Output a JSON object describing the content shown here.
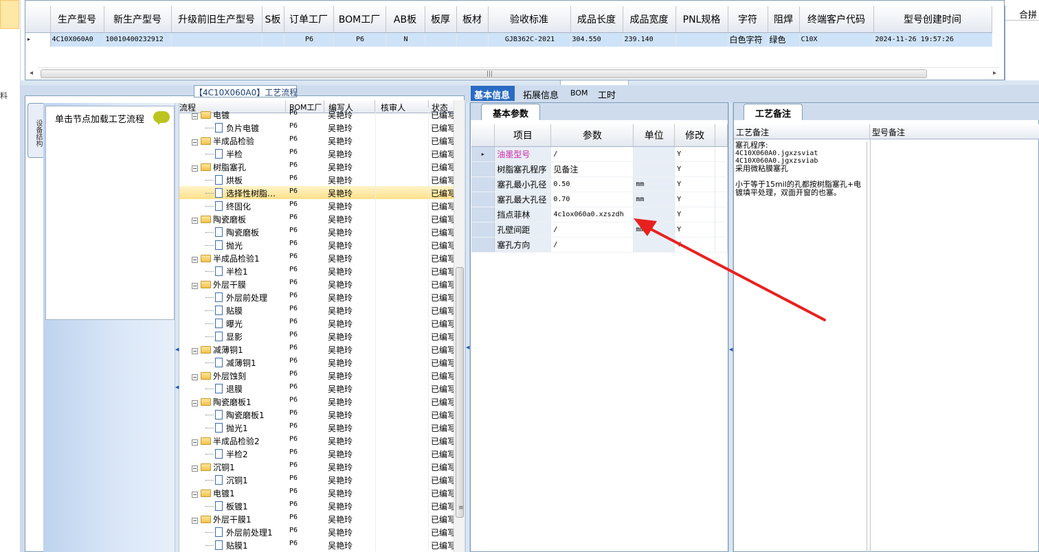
{
  "left_strip": {
    "label": "料"
  },
  "top_grid": {
    "columns": [
      "生产型号",
      "新生产型号",
      "升级前旧生产型号",
      "S板",
      "订单工厂",
      "BOM工厂",
      "AB板",
      "板厚",
      "板材",
      "验收标准",
      "成品长度",
      "成品宽度",
      "PNL规格",
      "字符",
      "阻焊",
      "终端客户代码",
      "型号创建时间"
    ],
    "row": {
      "indicator": "▸",
      "cells": [
        "4C10X060A0",
        "10010400232912",
        "",
        "",
        "P6",
        "P6",
        "N",
        "",
        "",
        "GJB362C-2021",
        "304.550",
        "239.140",
        "",
        "白色字符",
        "绿色",
        "C10X",
        "2024-11-26 19:57:26"
      ]
    },
    "right_header": "合拼",
    "scroll_grip": "|||",
    "scroll_left": "◂",
    "scroll_right": "▸"
  },
  "flow_panel": {
    "title": "【4C10X060A0】工艺流程",
    "vertical_tab": "设备结构",
    "hint": "单击节点加载工艺流程",
    "tree_headers": [
      "流程",
      "BOM工厂",
      "编写人",
      "核审人",
      "状态"
    ],
    "rows": [
      {
        "level": 1,
        "name": "电镀",
        "bom": "P6",
        "writer": "吴艳玲",
        "status": "已编写"
      },
      {
        "level": 2,
        "name": "负片电镀",
        "bom": "P6",
        "writer": "吴艳玲",
        "status": "已编写"
      },
      {
        "level": 1,
        "name": "半成品检验",
        "bom": "P6",
        "writer": "吴艳玲",
        "status": "已编写"
      },
      {
        "level": 2,
        "name": "半检",
        "bom": "P6",
        "writer": "吴艳玲",
        "status": "已编写"
      },
      {
        "level": 1,
        "name": "树脂塞孔",
        "bom": "P6",
        "writer": "吴艳玲",
        "status": "已编写"
      },
      {
        "level": 2,
        "name": "烘板",
        "bom": "P6",
        "writer": "吴艳玲",
        "status": "已编写"
      },
      {
        "level": 2,
        "name": "选择性树脂…",
        "bom": "P6",
        "writer": "吴艳玲",
        "status": "已编写",
        "selected": true
      },
      {
        "level": 2,
        "name": "终固化",
        "bom": "P6",
        "writer": "吴艳玲",
        "status": "已编写"
      },
      {
        "level": 1,
        "name": "陶瓷磨板",
        "bom": "P6",
        "writer": "吴艳玲",
        "status": "已编写"
      },
      {
        "level": 2,
        "name": "陶瓷磨板",
        "bom": "P6",
        "writer": "吴艳玲",
        "status": "已编写"
      },
      {
        "level": 2,
        "name": "抛光",
        "bom": "P6",
        "writer": "吴艳玲",
        "status": "已编写"
      },
      {
        "level": 1,
        "name": "半成品检验1",
        "bom": "P6",
        "writer": "吴艳玲",
        "status": "已编写"
      },
      {
        "level": 2,
        "name": "半检1",
        "bom": "P6",
        "writer": "吴艳玲",
        "status": "已编写"
      },
      {
        "level": 1,
        "name": "外层干膜",
        "bom": "P6",
        "writer": "吴艳玲",
        "status": "已编写"
      },
      {
        "level": 2,
        "name": "外层前处理",
        "bom": "P6",
        "writer": "吴艳玲",
        "status": "已编写"
      },
      {
        "level": 2,
        "name": "贴膜",
        "bom": "P6",
        "writer": "吴艳玲",
        "status": "已编写"
      },
      {
        "level": 2,
        "name": "曝光",
        "bom": "P6",
        "writer": "吴艳玲",
        "status": "已编写"
      },
      {
        "level": 2,
        "name": "显影",
        "bom": "P6",
        "writer": "吴艳玲",
        "status": "已编写"
      },
      {
        "level": 1,
        "name": "减薄铜1",
        "bom": "P6",
        "writer": "吴艳玲",
        "status": "已编写"
      },
      {
        "level": 2,
        "name": "减薄铜1",
        "bom": "P6",
        "writer": "吴艳玲",
        "status": "已编写"
      },
      {
        "level": 1,
        "name": "外层蚀刻",
        "bom": "P6",
        "writer": "吴艳玲",
        "status": "已编写"
      },
      {
        "level": 2,
        "name": "退膜",
        "bom": "P6",
        "writer": "吴艳玲",
        "status": "已编写"
      },
      {
        "level": 1,
        "name": "陶瓷磨板1",
        "bom": "P6",
        "writer": "吴艳玲",
        "status": "已编写"
      },
      {
        "level": 2,
        "name": "陶瓷磨板1",
        "bom": "P6",
        "writer": "吴艳玲",
        "status": "已编写"
      },
      {
        "level": 2,
        "name": "抛光1",
        "bom": "P6",
        "writer": "吴艳玲",
        "status": "已编写"
      },
      {
        "level": 1,
        "name": "半成品检验2",
        "bom": "P6",
        "writer": "吴艳玲",
        "status": "已编写"
      },
      {
        "level": 2,
        "name": "半检2",
        "bom": "P6",
        "writer": "吴艳玲",
        "status": "已编写"
      },
      {
        "level": 1,
        "name": "沉铜1",
        "bom": "P6",
        "writer": "吴艳玲",
        "status": "已编写"
      },
      {
        "level": 2,
        "name": "沉铜1",
        "bom": "P6",
        "writer": "吴艳玲",
        "status": "已编写"
      },
      {
        "level": 1,
        "name": "电镀1",
        "bom": "P6",
        "writer": "吴艳玲",
        "status": "已编写"
      },
      {
        "level": 2,
        "name": "板镀1",
        "bom": "P6",
        "writer": "吴艳玲",
        "status": "已编写"
      },
      {
        "level": 1,
        "name": "外层干膜1",
        "bom": "P6",
        "writer": "吴艳玲",
        "status": "已编写"
      },
      {
        "level": 2,
        "name": "外层前处理1",
        "bom": "P6",
        "writer": "吴艳玲",
        "status": "已编写"
      },
      {
        "level": 2,
        "name": "贴膜1",
        "bom": "P6",
        "writer": "吴艳玲",
        "status": "已编写"
      }
    ],
    "scroll_grip": "≡"
  },
  "middle": {
    "tabs": [
      "基本信息",
      "拓展信息",
      "BOM",
      "工时"
    ],
    "param_tab": "基本参数",
    "param_headers": [
      "项目",
      "参数",
      "单位",
      "修改"
    ],
    "params": [
      {
        "indicator": "▸",
        "item": "油墨型号",
        "value": "/",
        "unit": "",
        "mod": "Y"
      },
      {
        "indicator": "",
        "item": "树脂塞孔程序",
        "value": "见备注",
        "unit": "",
        "mod": "Y"
      },
      {
        "indicator": "",
        "item": "塞孔最小孔径",
        "value": "0.50",
        "unit": "mm",
        "mod": "Y"
      },
      {
        "indicator": "",
        "item": "塞孔最大孔径",
        "value": "0.70",
        "unit": "mm",
        "mod": "Y"
      },
      {
        "indicator": "",
        "item": "挡点菲林",
        "value": "4c1ox060a0.xzszdh",
        "unit": "",
        "mod": "Y"
      },
      {
        "indicator": "",
        "item": "孔壁间距",
        "value": "/",
        "unit": "mm",
        "mod": "Y"
      },
      {
        "indicator": "",
        "item": "塞孔方向",
        "value": "/",
        "unit": "",
        "mod": "Y"
      }
    ]
  },
  "remarks": {
    "tab": "工艺备注",
    "headers": [
      "工艺备注",
      "型号备注"
    ],
    "text_line1": "塞孔程序:",
    "text_line2": "4C10X060A0.jgxzsviat",
    "text_line3": "4C10X060A0.jgxzsviab",
    "text_line4": "采用微粘膜塞孔",
    "text_line5": "小于等于15mil的孔都按树脂塞孔+电镀填平处理，双面开窗的也塞。"
  },
  "annotation": {
    "color": "#e8211f"
  }
}
